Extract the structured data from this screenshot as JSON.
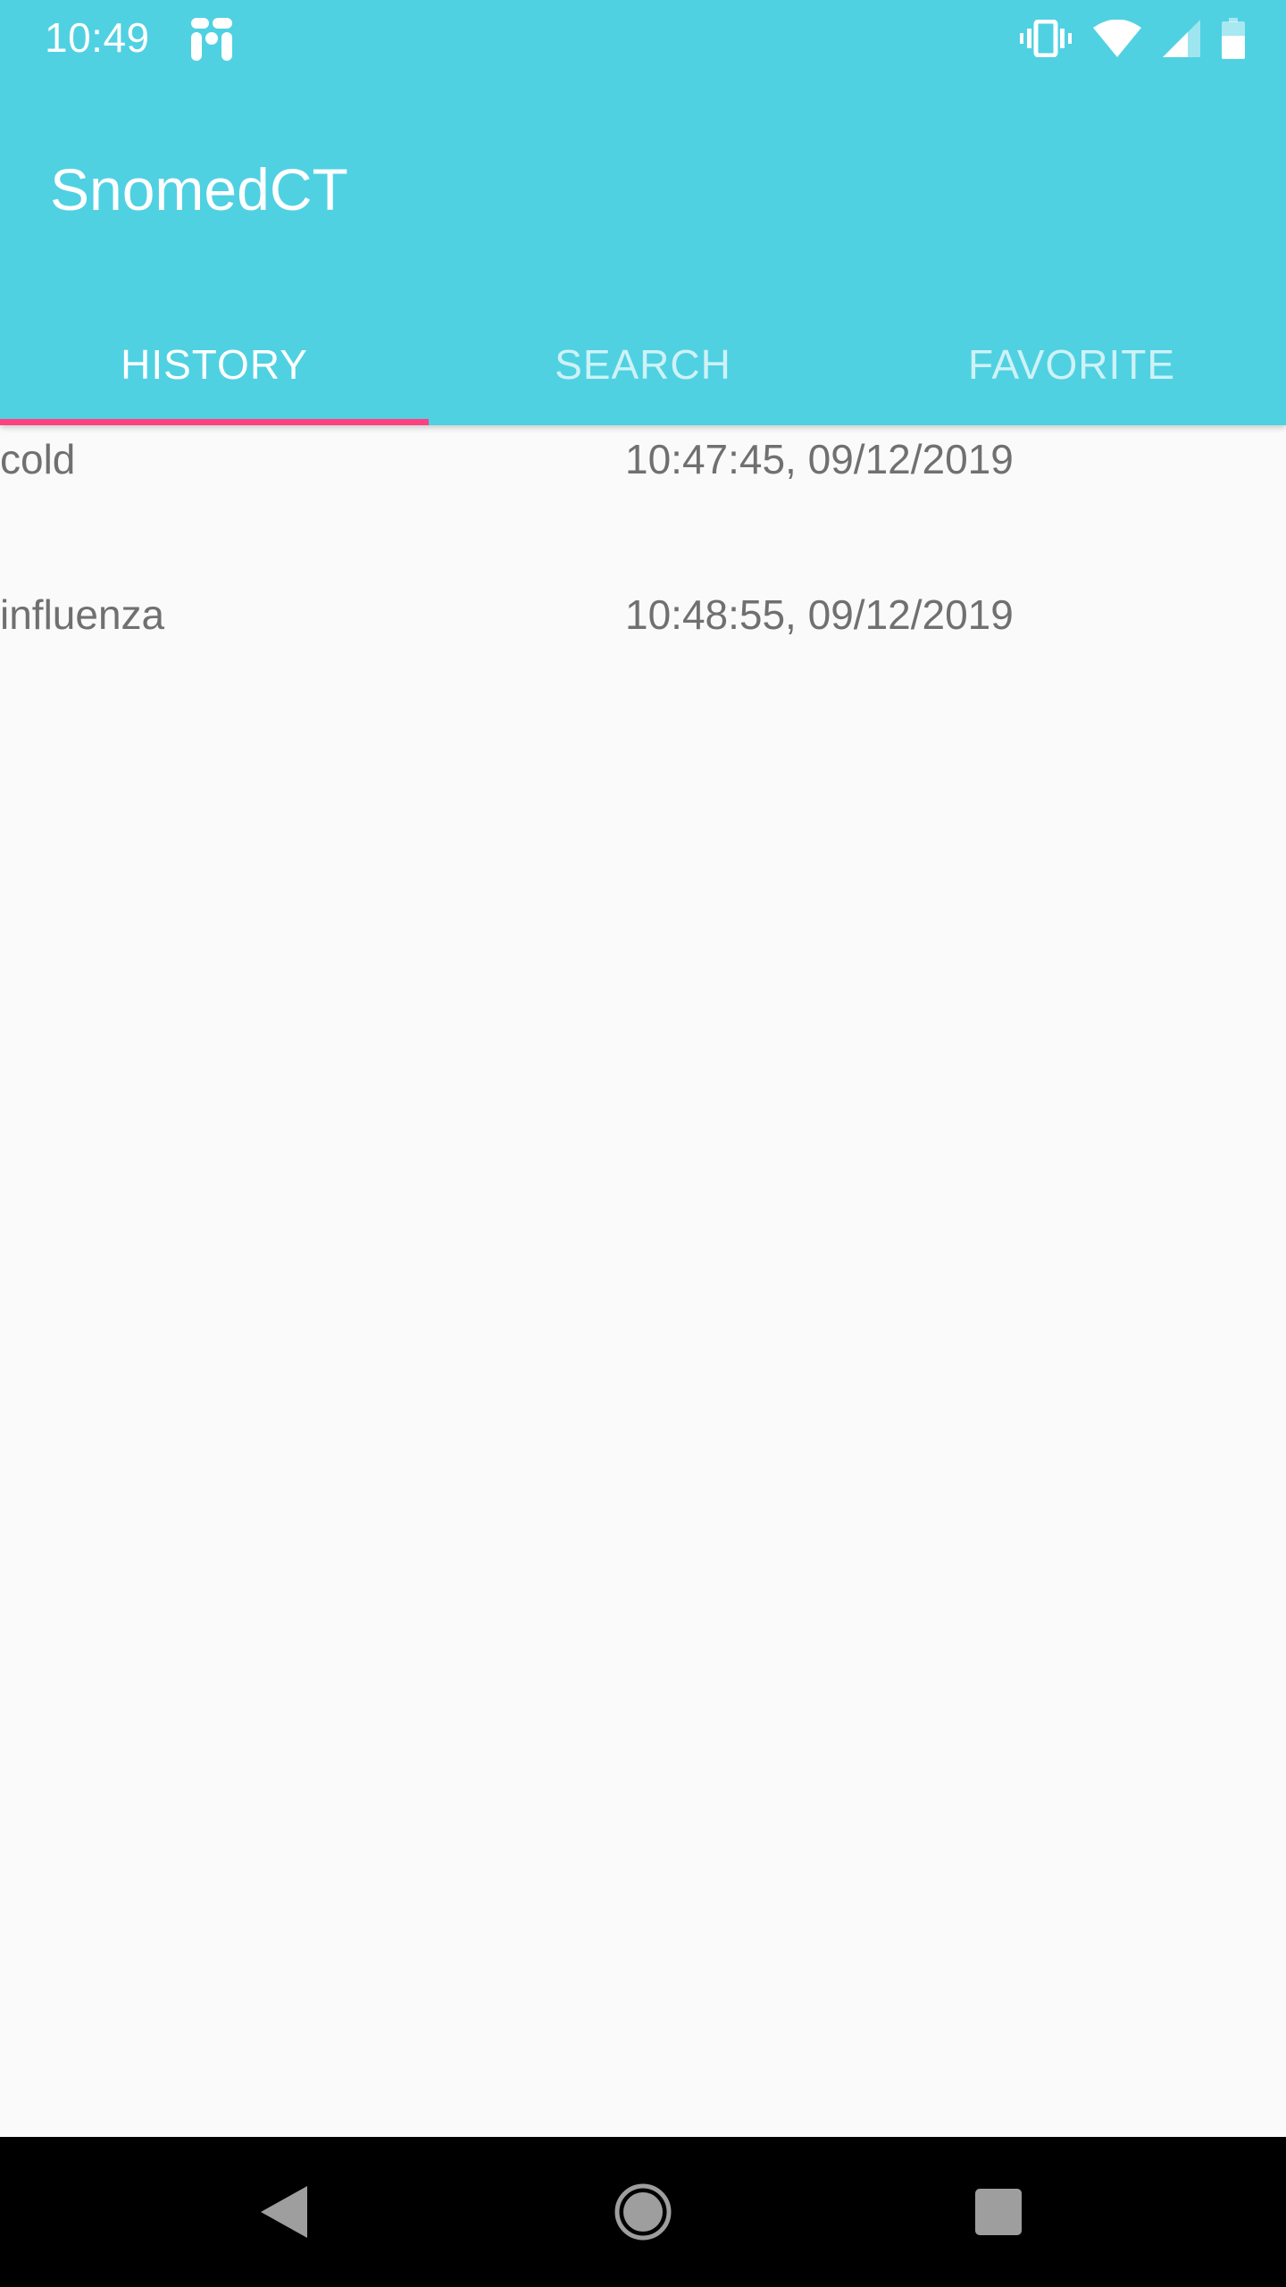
{
  "status_bar": {
    "time": "10:49",
    "app_icon": "notification-app-icon",
    "icons": [
      "vibrate-icon",
      "wifi-icon",
      "cellular-signal-icon",
      "battery-icon"
    ]
  },
  "toolbar": {
    "title": "SnomedCT"
  },
  "tabs": [
    {
      "label": "HISTORY",
      "active": true
    },
    {
      "label": "SEARCH",
      "active": false
    },
    {
      "label": "FAVORITE",
      "active": false
    }
  ],
  "history": [
    {
      "term": "cold",
      "timestamp": "10:47:45, 09/12/2019"
    },
    {
      "term": "influenza",
      "timestamp": "10:48:55, 09/12/2019"
    }
  ],
  "nav_bar": {
    "buttons": [
      "back-icon",
      "home-icon",
      "recents-icon"
    ]
  },
  "colors": {
    "primary": "#4fd1e2",
    "accent": "#ff4081",
    "background": "#fafafa",
    "row_text": "#707070"
  }
}
